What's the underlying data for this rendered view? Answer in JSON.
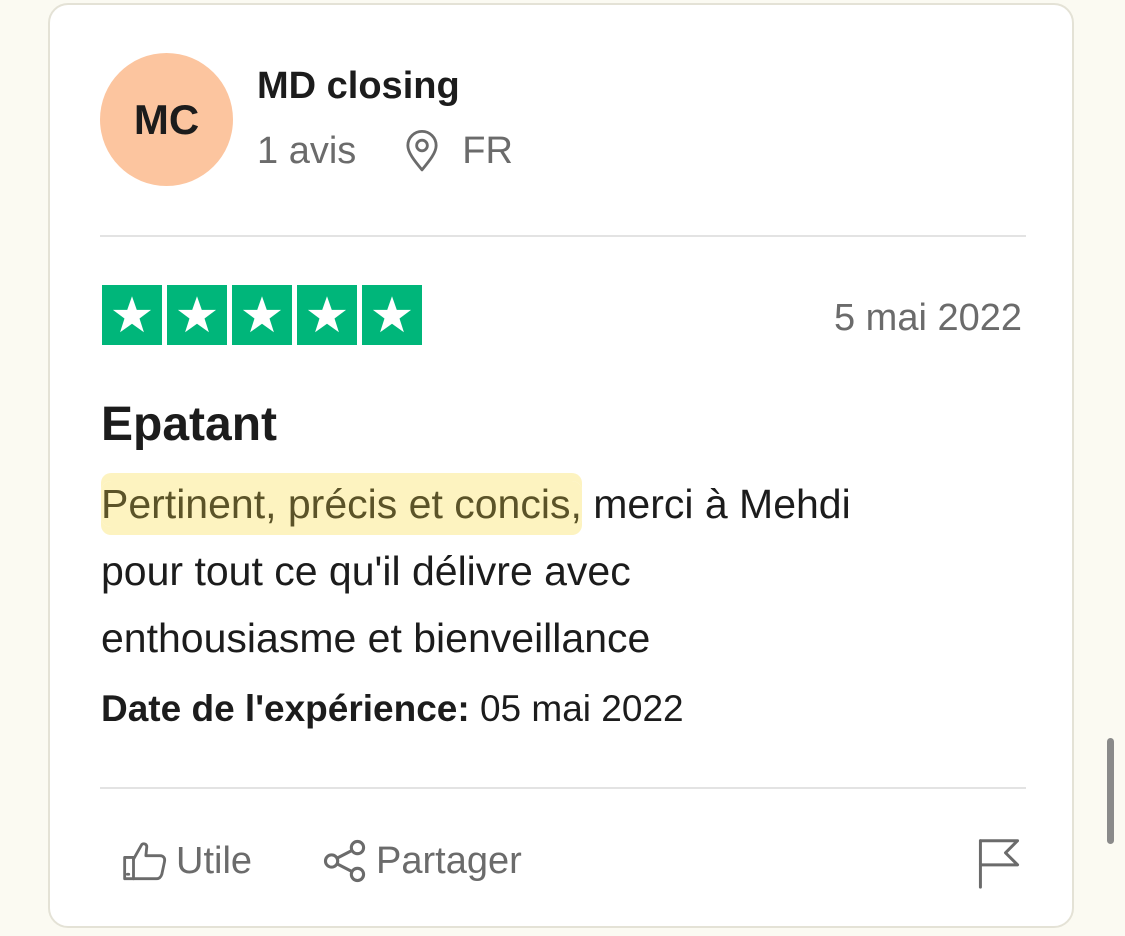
{
  "reviewer": {
    "initials": "MC",
    "name": "MD closing",
    "reviews_count": "1 avis",
    "country": "FR",
    "avatar_color": "#fcc59f"
  },
  "review": {
    "rating": 5,
    "max_rating": 5,
    "star_color": "#00b67a",
    "date": "5 mai 2022",
    "title": "Epatant",
    "body_highlight": "Pertinent, précis et concis,",
    "body_line1_rest": " merci à Mehdi",
    "body_line2": "pour tout ce qu'il délivre avec",
    "body_line3": "enthousiasme et bienveillance",
    "experience_label": "Date de l'expérience:",
    "experience_date": " 05 mai 2022"
  },
  "actions": {
    "useful_label": "Utile",
    "share_label": "Partager"
  },
  "icons": {
    "location": "map-pin-icon",
    "useful": "thumbs-up-icon",
    "share": "share-icon",
    "report": "flag-icon",
    "star": "star-icon"
  }
}
